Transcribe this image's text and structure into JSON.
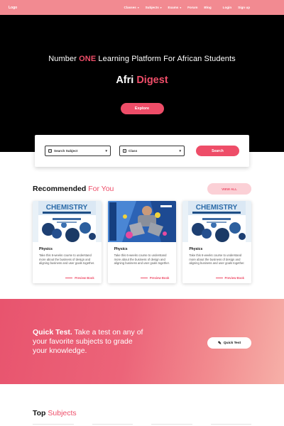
{
  "nav": {
    "logo": "Logo",
    "links": [
      {
        "label": "Classes",
        "dropdown": true
      },
      {
        "label": "Subjects",
        "dropdown": true
      },
      {
        "label": "Exams",
        "dropdown": true
      },
      {
        "label": "Forum",
        "dropdown": false
      },
      {
        "label": "Blog",
        "dropdown": false
      }
    ],
    "login": "Login",
    "signup": "Sign up"
  },
  "hero": {
    "tagline_pre": "Number ",
    "tagline_accent": "ONE",
    "tagline_post": " Learning Platform For African Students",
    "title_main": "Afri ",
    "title_accent": "Digest",
    "explore": "Explore"
  },
  "search": {
    "subject_placeholder": "Search Subject",
    "class_placeholder": "Class",
    "button": "Search"
  },
  "recommended": {
    "title_bold": "Recommended",
    "title_light": " For You",
    "view_all": "VIEW ALL",
    "cards": [
      {
        "subject": "Physics",
        "desc": "Take this 6-weeks course to understand more about the business of design and aligning business and user goals together.",
        "link": "Preview Book",
        "cover": "CHEMISTRY"
      },
      {
        "subject": "Physics",
        "desc": "Take this 6-weeks course to understand more about the business of design and aligning business and user goals together.",
        "link": "Preview Book",
        "cover": "PHOTO"
      },
      {
        "subject": "Physics",
        "desc": "Take this 6-weeks course to understand more about the business of design and aligning business and user goals together.",
        "link": "Preview Book",
        "cover": "CHEMISTRY"
      }
    ]
  },
  "quick_test": {
    "bold": "Quick Test.",
    "text": " Take a test on any of your favorite subjects to grade your knowledge.",
    "button": "Quick Test",
    "icon": "pencil-icon"
  },
  "top_subjects": {
    "bold": "Top",
    "light": " Subjects"
  },
  "colors": {
    "accent": "#ee4d68",
    "nav": "#f28a91",
    "hero_bg": "#000000"
  }
}
